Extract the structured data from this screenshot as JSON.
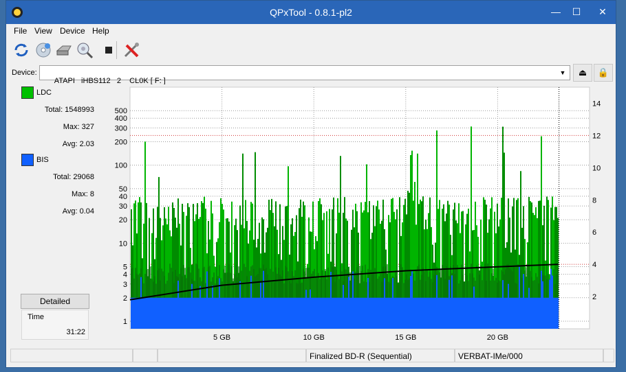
{
  "window": {
    "title": "QPxTool - 0.8.1-pl2",
    "minimize_glyph": "—",
    "maximize_glyph": "☐",
    "close_glyph": "✕"
  },
  "menu": [
    "File",
    "View",
    "Device",
    "Help"
  ],
  "toolbar": {
    "icons": [
      "refresh-icon",
      "disc-info-icon",
      "drive-icon",
      "scan-icon",
      "stop-icon",
      "settings-tools-icon"
    ]
  },
  "device": {
    "label": "Device:",
    "value": "ATAPI   iHBS112   2    CL0K [ F: ]",
    "dropdown_glyph": "▼",
    "eject_glyph": "⏏",
    "lock_glyph": "🔒"
  },
  "stats": {
    "ldc": {
      "name": "LDC",
      "color": "#00c000",
      "total": "Total: 1548993",
      "max": "Max: 327",
      "avg": "Avg: 2.03"
    },
    "bis": {
      "name": "BIS",
      "color": "#1060ff",
      "total": "Total: 29068",
      "max": "Max: 8",
      "avg": "Avg: 0.04"
    }
  },
  "detailed_button": "Detailed",
  "time": {
    "label": "Time",
    "value": "31:22"
  },
  "status": {
    "cells": [
      "",
      "",
      "",
      "Finalized BD-R (Sequential)",
      "VERBAT-IMe/000",
      ""
    ]
  },
  "chart_data": {
    "type": "bar",
    "title": "",
    "xlabel": "",
    "ylabel": "",
    "x_ticks": [
      "5 GB",
      "10 GB",
      "15 GB",
      "20 GB"
    ],
    "x_tick_values": [
      5,
      10,
      15,
      20
    ],
    "xlim": [
      0,
      25
    ],
    "y_left_scale": "log",
    "y_left_ticks": [
      "1",
      "2",
      "3",
      "4",
      "5",
      "10",
      "20",
      "30",
      "40",
      "50",
      "100",
      "200",
      "300",
      "400",
      "500"
    ],
    "y_left_values": [
      1,
      2,
      3,
      4,
      5,
      10,
      20,
      30,
      40,
      50,
      100,
      200,
      300,
      400,
      500
    ],
    "ylim_left": [
      0.8,
      1000
    ],
    "y_right_ticks": [
      "2",
      "4",
      "6",
      "8",
      "10",
      "12",
      "14"
    ],
    "y_right_values": [
      2,
      4,
      6,
      8,
      10,
      12,
      14
    ],
    "ylim_right": [
      0,
      15
    ],
    "data_end_gb": 23.3,
    "grid": true,
    "series": [
      {
        "name": "LDC",
        "color": "#00b400",
        "typical_peak": 40,
        "max": 327
      },
      {
        "name": "BIS",
        "color": "#1060ff",
        "typical_level": 2,
        "max": 8
      },
      {
        "name": "",
        "color": "#000000",
        "type": "line",
        "x": [
          0,
          5,
          10,
          15,
          20,
          23.3
        ],
        "y": [
          1.8,
          2.7,
          3.2,
          3.6,
          3.85,
          4.0
        ]
      }
    ]
  }
}
